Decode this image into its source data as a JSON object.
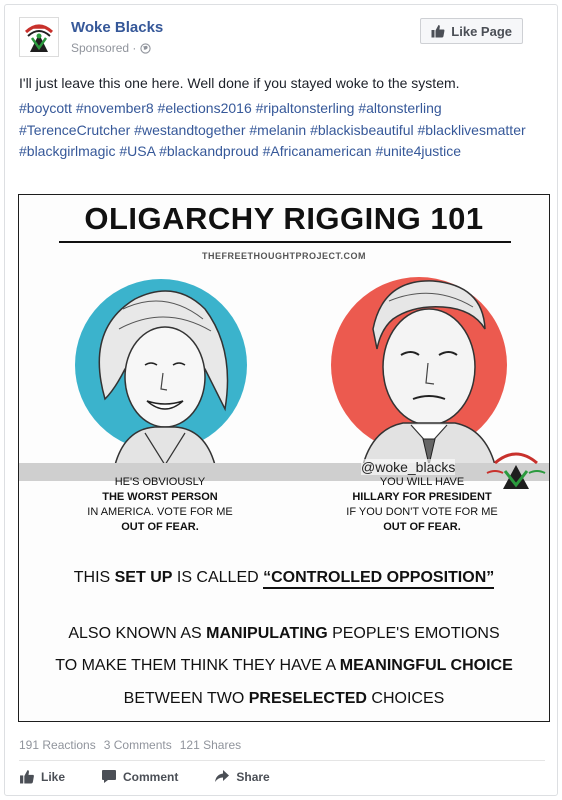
{
  "post": {
    "page_name": "Woke Blacks",
    "sponsored_label": "Sponsored ·",
    "like_page_label": "Like Page",
    "text": "I'll just leave this one here. Well done if you stayed woke to the system.",
    "hashtags": [
      "#boycott",
      "#november8",
      "#elections2016",
      "#ripaltonsterling",
      "#altonsterling",
      "#TerenceCrutcher",
      "#westandtogether",
      "#melanin",
      "#blackisbeautiful",
      "#blacklivesmatter",
      "#blackgirlmagic",
      "#USA",
      "#blackandproud",
      "#Africanamerican",
      "#unite4justice"
    ]
  },
  "image": {
    "title": "OLIGARCHY RIGGING 101",
    "watermark": "THEFREETHOUGHTPROJECT.COM",
    "handle": "@woke_blacks",
    "caption_left": {
      "line1": "HE'S OBVIOUSLY",
      "line2": "THE WORST PERSON",
      "line3": "IN AMERICA. VOTE FOR ME",
      "line4": "OUT OF FEAR."
    },
    "caption_right": {
      "line1": "YOU WILL HAVE",
      "line2": "HILLARY FOR PRESIDENT",
      "line3": "IF YOU DON'T VOTE FOR ME",
      "line4": "OUT OF FEAR."
    },
    "line1": {
      "a": "THIS ",
      "b": "SET UP",
      "c": " IS CALLED ",
      "d": "“CONTROLLED OPPOSITION”"
    },
    "line2": {
      "a": "ALSO KNOWN AS ",
      "b": "MANIPULATING",
      "c": " PEOPLE'S EMOTIONS"
    },
    "line3": {
      "a": "TO MAKE THEM THINK THEY HAVE A ",
      "b": "MEANINGFUL CHOICE"
    },
    "line4": {
      "a": "BETWEEN TWO ",
      "b": "PRESELECTED",
      "c": " CHOICES"
    },
    "colors": {
      "left_circle": "#3bb3cc",
      "right_circle": "#ec5a4f"
    }
  },
  "stats": {
    "reactions": "191 Reactions",
    "comments": "3 Comments",
    "shares": "121 Shares"
  },
  "actions": {
    "like": "Like",
    "comment": "Comment",
    "share": "Share"
  },
  "icons": {
    "avatar": "woke-blacks-logo-icon",
    "globe": "globe-icon",
    "thumb": "thumbs-up-icon",
    "comment": "comment-icon",
    "share": "share-arrow-icon"
  },
  "brand": {
    "link_color": "#365899",
    "muted_color": "#90949c"
  }
}
